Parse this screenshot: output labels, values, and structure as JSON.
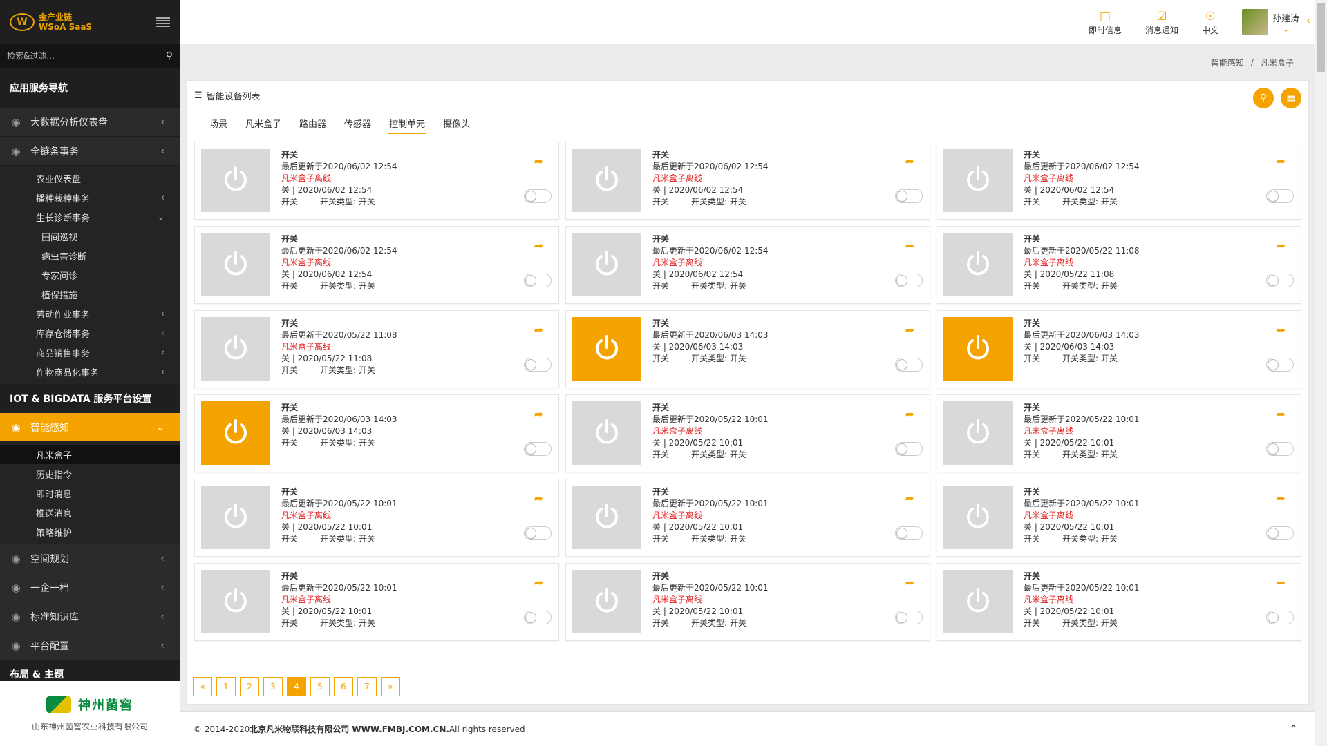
{
  "sidebar": {
    "logo_mark": "W",
    "logo_line1": "金产业链",
    "logo_line2": "WSoA SaaS",
    "search_placeholder": "检索&过滤...",
    "nav_section_title": "应用服务导航",
    "items_group1": [
      {
        "label": "大数据分析仪表盘"
      },
      {
        "label": "全链条事务"
      }
    ],
    "sub_group1": [
      {
        "label": "农业仪表盘"
      },
      {
        "label": "播种栽种事务"
      },
      {
        "label": "生长诊断事务"
      }
    ],
    "third_group": [
      {
        "label": "田间巡视"
      },
      {
        "label": "病虫害诊断"
      },
      {
        "label": "专家问诊"
      },
      {
        "label": "植保措施"
      }
    ],
    "sub_group2": [
      {
        "label": "劳动作业事务"
      },
      {
        "label": "库存仓储事务"
      },
      {
        "label": "商品销售事务"
      },
      {
        "label": "作物商品化事务"
      }
    ],
    "iot_section_title": "IOT & BIGDATA 服务平台设置",
    "active_item": "智能感知",
    "active_sub": [
      {
        "label": "凡米盒子"
      },
      {
        "label": "历史指令"
      },
      {
        "label": "即时消息"
      },
      {
        "label": "推送消息"
      },
      {
        "label": "策略维护"
      }
    ],
    "items_group2": [
      {
        "label": "空间规划"
      },
      {
        "label": "一企一档"
      },
      {
        "label": "标准知识库"
      },
      {
        "label": "平台配置"
      }
    ],
    "layout_section_title": "布局 & 主题",
    "brand_name": "神州菌窖",
    "brand_company": "山东神州菌窖农业科技有限公司"
  },
  "header": {
    "instant_msg": "即时信息",
    "notify": "消息通知",
    "lang": "中文",
    "user_name": "孙建涛"
  },
  "breadcrumb": {
    "parent": "智能感知",
    "sep": "/",
    "current": "凡米盒子"
  },
  "panel": {
    "title": "智能设备列表",
    "tabs": [
      {
        "label": "场景"
      },
      {
        "label": "凡米盒子"
      },
      {
        "label": "路由器"
      },
      {
        "label": "传感器"
      },
      {
        "label": "控制单元"
      },
      {
        "label": "摄像头"
      }
    ],
    "active_tab": 4
  },
  "cards": [
    {
      "name": "开关",
      "updated": "最后更新于2020/06/02 12:54",
      "offline": "凡米盒子离线",
      "state": "关 | 2020/06/02 12:54",
      "type1": "开关",
      "type2": "开关类型: 开关",
      "on": false
    },
    {
      "name": "开关",
      "updated": "最后更新于2020/06/02 12:54",
      "offline": "凡米盒子离线",
      "state": "关 | 2020/06/02 12:54",
      "type1": "开关",
      "type2": "开关类型: 开关",
      "on": false
    },
    {
      "name": "开关",
      "updated": "最后更新于2020/06/02 12:54",
      "offline": "凡米盒子离线",
      "state": "关 | 2020/06/02 12:54",
      "type1": "开关",
      "type2": "开关类型: 开关",
      "on": false
    },
    {
      "name": "开关",
      "updated": "最后更新于2020/06/02 12:54",
      "offline": "凡米盒子离线",
      "state": "关 | 2020/06/02 12:54",
      "type1": "开关",
      "type2": "开关类型: 开关",
      "on": false
    },
    {
      "name": "开关",
      "updated": "最后更新于2020/06/02 12:54",
      "offline": "凡米盒子离线",
      "state": "关 | 2020/06/02 12:54",
      "type1": "开关",
      "type2": "开关类型: 开关",
      "on": false
    },
    {
      "name": "开关",
      "updated": "最后更新于2020/05/22 11:08",
      "offline": "凡米盒子离线",
      "state": "关 | 2020/05/22 11:08",
      "type1": "开关",
      "type2": "开关类型: 开关",
      "on": false
    },
    {
      "name": "开关",
      "updated": "最后更新于2020/05/22 11:08",
      "offline": "凡米盒子离线",
      "state": "关 | 2020/05/22 11:08",
      "type1": "开关",
      "type2": "开关类型: 开关",
      "on": false
    },
    {
      "name": "开关",
      "updated": "最后更新于2020/06/03 14:03",
      "offline": "",
      "state": "关 | 2020/06/03 14:03",
      "type1": "开关",
      "type2": "开关类型: 开关",
      "on": true
    },
    {
      "name": "开关",
      "updated": "最后更新于2020/06/03 14:03",
      "offline": "",
      "state": "关 | 2020/06/03 14:03",
      "type1": "开关",
      "type2": "开关类型: 开关",
      "on": true
    },
    {
      "name": "开关",
      "updated": "最后更新于2020/06/03 14:03",
      "offline": "",
      "state": "关 | 2020/06/03 14:03",
      "type1": "开关",
      "type2": "开关类型: 开关",
      "on": true
    },
    {
      "name": "开关",
      "updated": "最后更新于2020/05/22 10:01",
      "offline": "凡米盒子离线",
      "state": "关 | 2020/05/22 10:01",
      "type1": "开关",
      "type2": "开关类型: 开关",
      "on": false
    },
    {
      "name": "开关",
      "updated": "最后更新于2020/05/22 10:01",
      "offline": "凡米盒子离线",
      "state": "关 | 2020/05/22 10:01",
      "type1": "开关",
      "type2": "开关类型: 开关",
      "on": false
    },
    {
      "name": "开关",
      "updated": "最后更新于2020/05/22 10:01",
      "offline": "凡米盒子离线",
      "state": "关 | 2020/05/22 10:01",
      "type1": "开关",
      "type2": "开关类型: 开关",
      "on": false
    },
    {
      "name": "开关",
      "updated": "最后更新于2020/05/22 10:01",
      "offline": "凡米盒子离线",
      "state": "关 | 2020/05/22 10:01",
      "type1": "开关",
      "type2": "开关类型: 开关",
      "on": false
    },
    {
      "name": "开关",
      "updated": "最后更新于2020/05/22 10:01",
      "offline": "凡米盒子离线",
      "state": "关 | 2020/05/22 10:01",
      "type1": "开关",
      "type2": "开关类型: 开关",
      "on": false
    },
    {
      "name": "开关",
      "updated": "最后更新于2020/05/22 10:01",
      "offline": "凡米盒子离线",
      "state": "关 | 2020/05/22 10:01",
      "type1": "开关",
      "type2": "开关类型: 开关",
      "on": false
    },
    {
      "name": "开关",
      "updated": "最后更新于2020/05/22 10:01",
      "offline": "凡米盒子离线",
      "state": "关 | 2020/05/22 10:01",
      "type1": "开关",
      "type2": "开关类型: 开关",
      "on": false
    },
    {
      "name": "开关",
      "updated": "最后更新于2020/05/22 10:01",
      "offline": "凡米盒子离线",
      "state": "关 | 2020/05/22 10:01",
      "type1": "开关",
      "type2": "开关类型: 开关",
      "on": false
    }
  ],
  "pager": {
    "prev": "«",
    "pages": [
      "1",
      "2",
      "3",
      "4",
      "5",
      "6",
      "7"
    ],
    "active": "4",
    "next": "»"
  },
  "footer": {
    "copy": "© 2014-2020 ",
    "company": "北京凡米物联科技有限公司 WWW.FMBJ.COM.CN.",
    "rights": " All rights reserved"
  },
  "colors": {
    "accent": "#f5a300",
    "offline_red": "#e02020",
    "sidebar_bg": "#2b2b2b"
  }
}
